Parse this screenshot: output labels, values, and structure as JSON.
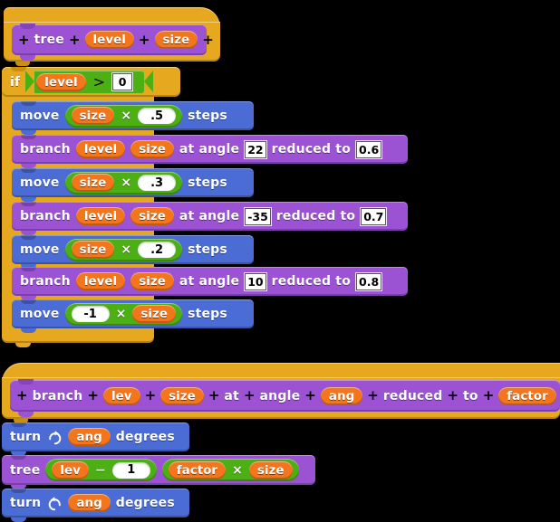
{
  "app": {
    "name": "Snap! block editor",
    "view": "script-pane"
  },
  "palette": {
    "motion_color": "#4a6cd4",
    "control_color": "#e6a81e",
    "operator_color": "#4caf14",
    "variable_color": "#f3761d",
    "custom_color": "#9b53d4",
    "input_color": "#ffffff",
    "background_color": "#000000"
  },
  "definitions": [
    {
      "id": "tree-definition",
      "hat_label": "tree-hat-block",
      "prototype": {
        "name": "tree",
        "parts": [
          {
            "type": "plus",
            "label": "+"
          },
          {
            "type": "text",
            "label": "tree"
          },
          {
            "type": "plus",
            "label": "+"
          },
          {
            "type": "var",
            "label": "level"
          },
          {
            "type": "plus",
            "label": "+"
          },
          {
            "type": "var",
            "label": "size"
          },
          {
            "type": "plus",
            "label": "+"
          }
        ]
      },
      "body": {
        "control": {
          "keyword": "if",
          "condition": {
            "left": "level",
            "operator": ">",
            "right": "0"
          }
        },
        "statements": [
          {
            "kind": "move",
            "keyword": "move",
            "trailing": "steps",
            "operand_left": "size",
            "operator": "×",
            "operand_right": ".5",
            "left_is_var": true
          },
          {
            "kind": "branch",
            "keyword": "branch",
            "arg1": "level",
            "arg2": "size",
            "mid_text": "at angle",
            "angle": "22",
            "tail_text": "reduced to",
            "factor": "0.6"
          },
          {
            "kind": "move",
            "keyword": "move",
            "trailing": "steps",
            "operand_left": "size",
            "operator": "×",
            "operand_right": ".3",
            "left_is_var": true
          },
          {
            "kind": "branch",
            "keyword": "branch",
            "arg1": "level",
            "arg2": "size",
            "mid_text": "at angle",
            "angle": "-35",
            "tail_text": "reduced to",
            "factor": "0.7"
          },
          {
            "kind": "move",
            "keyword": "move",
            "trailing": "steps",
            "operand_left": "size",
            "operator": "×",
            "operand_right": ".2",
            "left_is_var": true
          },
          {
            "kind": "branch",
            "keyword": "branch",
            "arg1": "level",
            "arg2": "size",
            "mid_text": "at angle",
            "angle": "10",
            "tail_text": "reduced to",
            "factor": "0.8"
          },
          {
            "kind": "move",
            "keyword": "move",
            "trailing": "steps",
            "operand_left": "-1",
            "operator": "×",
            "operand_right": "size",
            "left_is_var": false
          }
        ]
      }
    },
    {
      "id": "branch-definition",
      "hat_label": "branch-hat-block",
      "prototype": {
        "name": "branch",
        "parts": [
          {
            "type": "plus",
            "label": "+"
          },
          {
            "type": "text",
            "label": "branch"
          },
          {
            "type": "plus",
            "label": "+"
          },
          {
            "type": "var",
            "label": "lev"
          },
          {
            "type": "plus",
            "label": "+"
          },
          {
            "type": "var",
            "label": "size"
          },
          {
            "type": "plus",
            "label": "+"
          },
          {
            "type": "text",
            "label": "at"
          },
          {
            "type": "plus",
            "label": "+"
          },
          {
            "type": "text",
            "label": "angle"
          },
          {
            "type": "plus",
            "label": "+"
          },
          {
            "type": "var",
            "label": "ang"
          },
          {
            "type": "plus",
            "label": "+"
          },
          {
            "type": "text",
            "label": "reduced"
          },
          {
            "type": "plus",
            "label": "+"
          },
          {
            "type": "text",
            "label": "to"
          },
          {
            "type": "plus",
            "label": "+"
          },
          {
            "type": "var",
            "label": "factor"
          },
          {
            "type": "plus",
            "label": "+"
          }
        ]
      },
      "body": {
        "statements": [
          {
            "kind": "turn",
            "keyword": "turn",
            "icon": "turn-clockwise-icon",
            "var": "ang",
            "trailing": "degrees"
          },
          {
            "kind": "tree-call",
            "keyword": "tree",
            "arg1": {
              "left": "lev",
              "operator": "−",
              "right": "1"
            },
            "arg2": {
              "left": "factor",
              "operator": "×",
              "right": "size"
            }
          },
          {
            "kind": "turn",
            "keyword": "turn",
            "icon": "turn-counterclockwise-icon",
            "var": "ang",
            "trailing": "degrees"
          }
        ]
      }
    }
  ]
}
